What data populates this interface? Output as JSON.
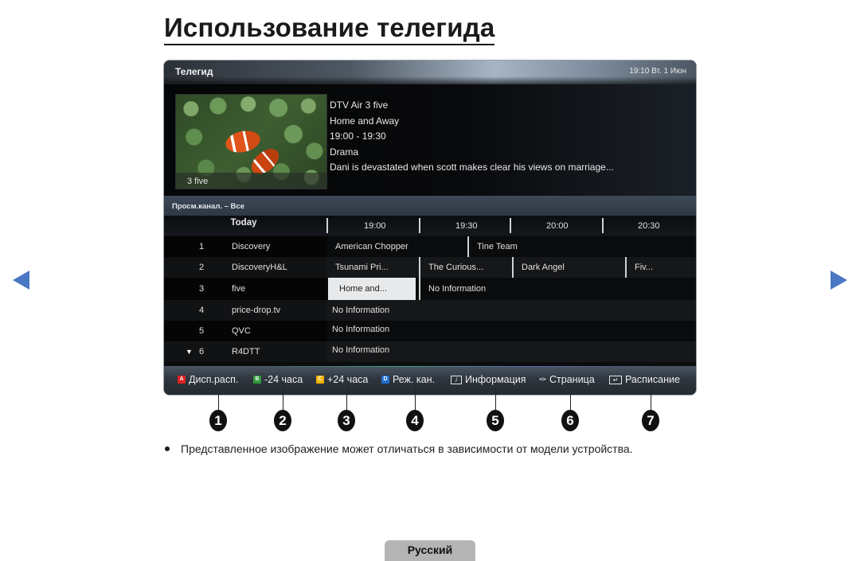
{
  "page": {
    "title": "Использование телегида",
    "note": "Представленное изображение может отличаться в зависимости от модели устройства.",
    "language_tab": "Русский",
    "nav": {
      "prev_icon": "triangle-left-icon",
      "next_icon": "triangle-right-icon",
      "arrow_color": "#4a77c4"
    }
  },
  "guide": {
    "header": {
      "title": "Телегид",
      "clock": "19:10 Вт. 1 Июн"
    },
    "preview": {
      "thumbnail_caption": "3 five",
      "channel": "DTV Air 3 five",
      "program": "Home and Away",
      "time": "19:00 - 19:30",
      "genre": "Drama",
      "description": "Dani is devastated when scott makes clear his views on marriage..."
    },
    "filter": "Просм.канал. – Все",
    "timeline": {
      "day": "Today",
      "slots": [
        "19:00",
        "19:30",
        "20:00",
        "20:30"
      ]
    },
    "channels": [
      {
        "number": "1",
        "name": "Discovery",
        "programs": [
          "American Chopper",
          "Tine Team"
        ]
      },
      {
        "number": "2",
        "name": "DiscoveryH&L",
        "programs": [
          "Tsunami Pri...",
          "The Curious...",
          "Dark Angel",
          "Fiv..."
        ]
      },
      {
        "number": "3",
        "name": "five",
        "programs": [
          "Home and...",
          "No Information"
        ],
        "selected_program": "Home and..."
      },
      {
        "number": "4",
        "name": "price-drop.tv",
        "programs": [
          "No Information"
        ]
      },
      {
        "number": "5",
        "name": "QVC",
        "programs": [
          "No Information"
        ]
      },
      {
        "number": "6",
        "name": "R4DTT",
        "programs": [
          "No Information"
        ],
        "indicator": "▼"
      }
    ],
    "keys": [
      {
        "badge": "A",
        "color": "#e02020",
        "label": "Дисп.расп."
      },
      {
        "badge": "B",
        "color": "#2e9a3a",
        "label": "-24 часа"
      },
      {
        "badge": "C",
        "color": "#f0b400",
        "label": "+24 часа"
      },
      {
        "badge": "D",
        "color": "#1f6fd0",
        "label": "Реж. кан."
      },
      {
        "icon": "info-icon",
        "glyph": "i",
        "label": "Информация"
      },
      {
        "icon": "page-up-down-icon",
        "glyph": "⌃⌄",
        "label": "Страница"
      },
      {
        "icon": "enter-icon",
        "glyph": "↵",
        "label": "Расписание"
      }
    ]
  },
  "callouts": [
    "1",
    "2",
    "3",
    "4",
    "5",
    "6",
    "7"
  ]
}
